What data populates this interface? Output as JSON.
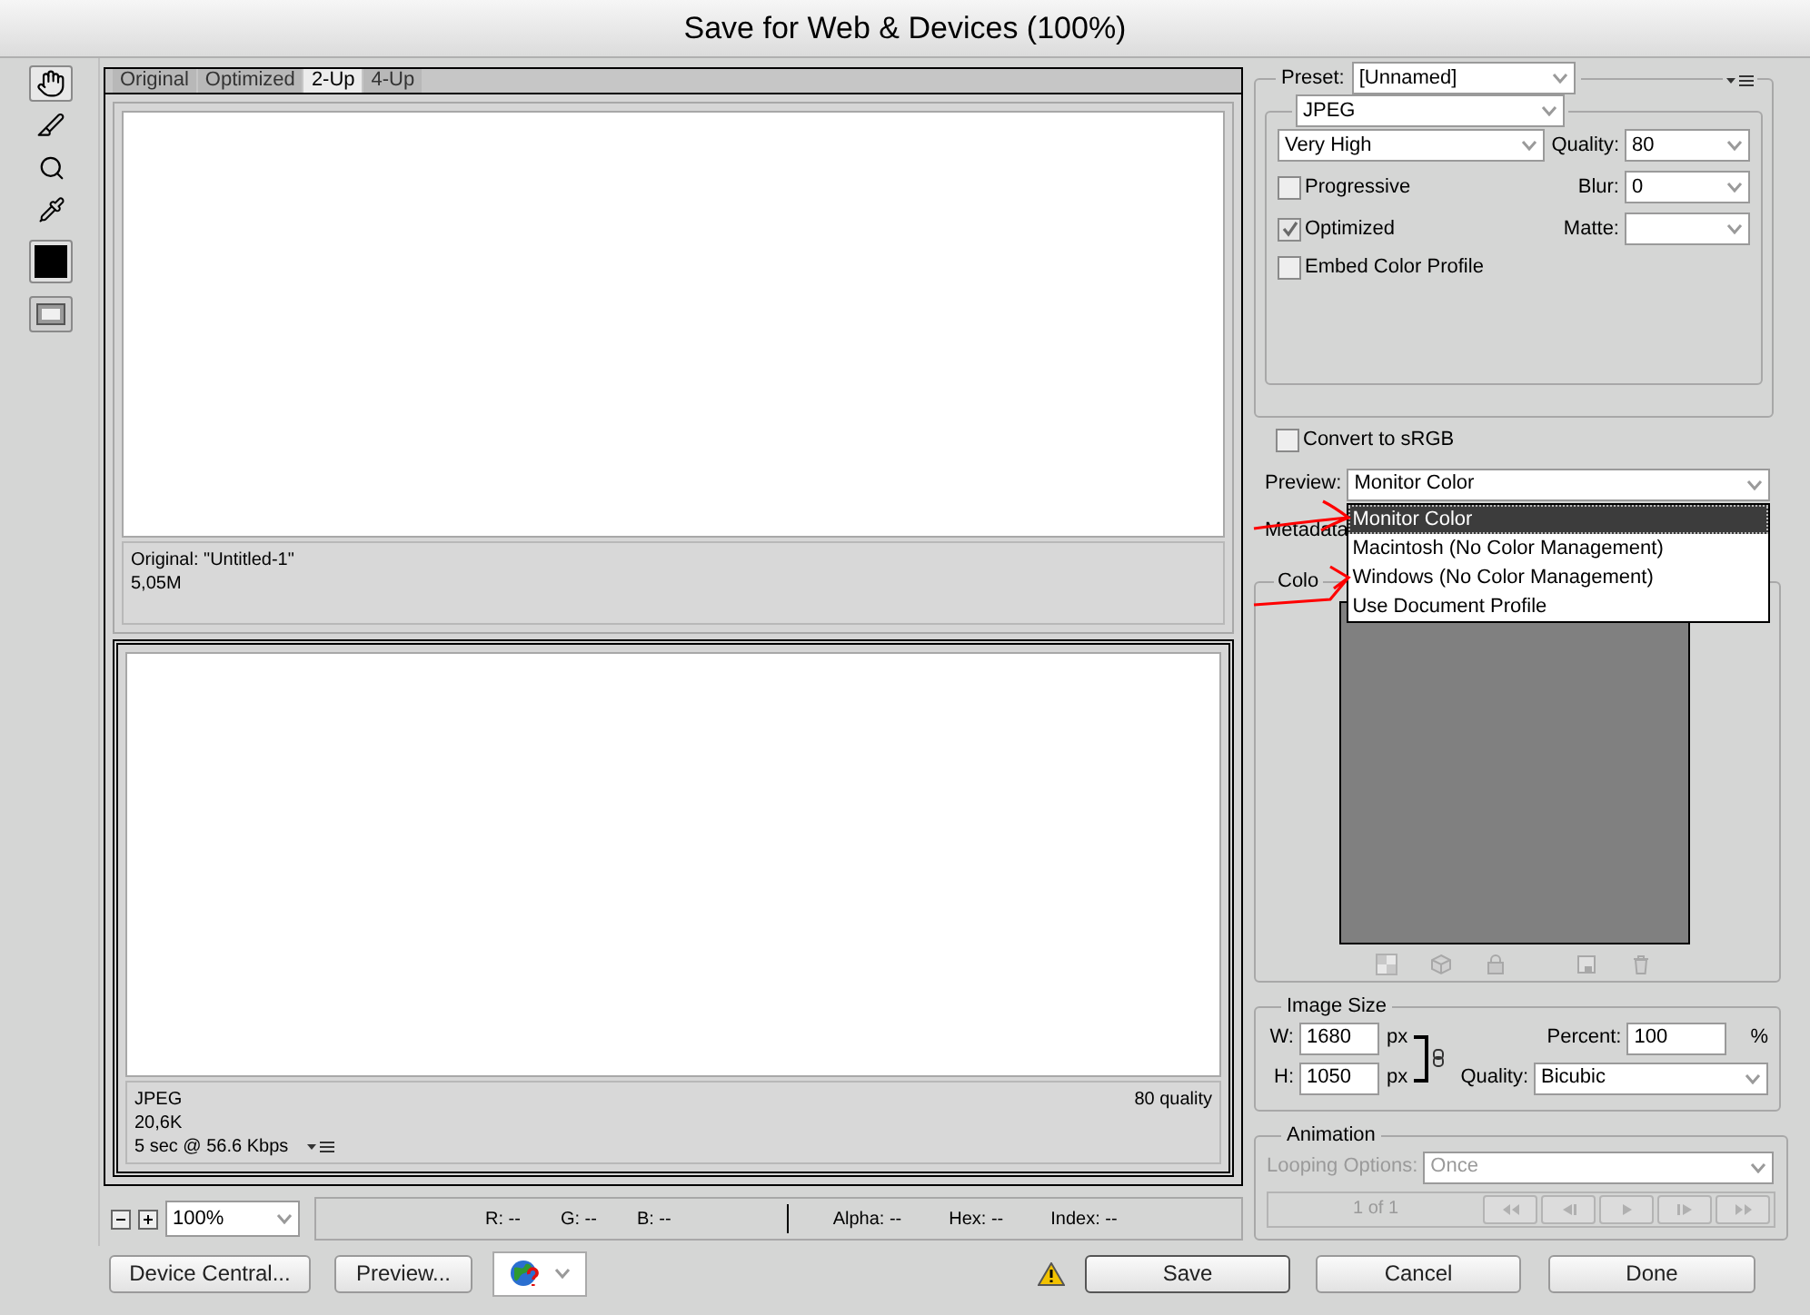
{
  "window": {
    "title": "Save for Web & Devices (100%)"
  },
  "tools": [
    {
      "kind": "hand",
      "selected": true
    },
    {
      "kind": "slice-select",
      "selected": false
    },
    {
      "kind": "zoom",
      "selected": false
    },
    {
      "kind": "eyedropper",
      "selected": false
    },
    {
      "kind": "swatch",
      "selected": false
    },
    {
      "kind": "slices-toggle",
      "selected": false
    }
  ],
  "view_tabs": [
    {
      "label": "Original",
      "selected": false
    },
    {
      "label": "Optimized",
      "selected": false
    },
    {
      "label": "2-Up",
      "selected": true
    },
    {
      "label": "4-Up",
      "selected": false
    }
  ],
  "panes": [
    {
      "info_left": [
        "Original: \"Untitled-1\"",
        "5,05M"
      ],
      "selected": false,
      "has_menu": false
    },
    {
      "info_left": [
        "JPEG",
        "20,6K",
        "5 sec @ 56.6 Kbps"
      ],
      "info_right": "80 quality",
      "selected": true,
      "has_menu": true
    }
  ],
  "zoom": {
    "value": "100%"
  },
  "readouts_color": [
    "R: --",
    "G: --",
    "B: --"
  ],
  "readouts_other": [
    "Alpha: --",
    "Hex: --",
    "Index: --"
  ],
  "settings": {
    "preset": {
      "label": "Preset:",
      "value": "[Unnamed]"
    },
    "format": "JPEG",
    "quality_preset": "Very High",
    "quality": {
      "label": "Quality:",
      "value": "80"
    },
    "blur": {
      "label": "Blur:",
      "value": "0"
    },
    "matte": {
      "label": "Matte:"
    },
    "options": [
      {
        "label": "Progressive",
        "checked": false
      },
      {
        "label": "Optimized",
        "checked": true
      },
      {
        "label": "Embed Color Profile",
        "checked": false
      }
    ],
    "convert": {
      "label": "Convert to sRGB",
      "checked": false
    },
    "preview": {
      "label": "Preview:",
      "value": "Monitor Color",
      "options": [
        {
          "label": "Monitor Color",
          "selected": true
        },
        {
          "label": "Macintosh (No Color Management)",
          "selected": false
        },
        {
          "label": "Windows (No Color Management)",
          "selected": false
        },
        {
          "label": "Use Document Profile",
          "selected": false
        }
      ]
    },
    "metadata_label": "Metadata",
    "color_table_label": "Colo"
  },
  "image_size": {
    "title": "Image Size",
    "width": {
      "label": "W:",
      "value": "1680",
      "unit": "px"
    },
    "height": {
      "label": "H:",
      "value": "1050",
      "unit": "px"
    },
    "percent": {
      "label": "Percent:",
      "value": "100",
      "unit": "%"
    },
    "quality": {
      "label": "Quality:",
      "value": "Bicubic"
    }
  },
  "animation": {
    "title": "Animation",
    "looping_label": "Looping Options:",
    "looping": "Once",
    "frame": "1 of 1",
    "disabled": true
  },
  "buttons": {
    "device_central": "Device Central...",
    "preview": "Preview...",
    "save": "Save",
    "cancel": "Cancel",
    "done": "Done"
  }
}
